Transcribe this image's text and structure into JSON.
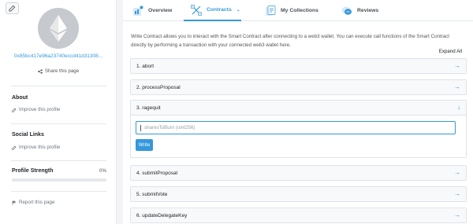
{
  "sidebar": {
    "address": "0x85bc417e96a23740eccd41d31308...",
    "share_label": "Share this page",
    "about": {
      "title": "About",
      "link": "Improve this profile"
    },
    "social": {
      "title": "Social Links",
      "link": "Improve this profile"
    },
    "strength": {
      "label": "Profile Strength",
      "value": "0%",
      "progress": 0
    },
    "report_label": "Report this page"
  },
  "tabs": [
    {
      "label": "Overview",
      "icon": "overview-icon"
    },
    {
      "label": "Contracts",
      "icon": "contracts-icon",
      "active": true
    },
    {
      "label": "My Collections",
      "icon": "collections-icon"
    },
    {
      "label": "Reviews",
      "icon": "reviews-icon"
    }
  ],
  "contracts": {
    "intro": "Write Contract allows you to interact with the Smart Contract after connecting to a web3 wallet. You can execute call functions of the Smart Contract directly by performing a transaction with your connected web3 wallet here.",
    "expand_all": "Expand All",
    "functions": [
      {
        "label": "1. abort"
      },
      {
        "label": "2. processProposal"
      },
      {
        "label": "3. ragequit",
        "open": true
      },
      {
        "label": "4. submitProposal"
      },
      {
        "label": "5. submitVote"
      },
      {
        "label": "6. updateDelegateKey"
      }
    ],
    "ragequit_input_placeholder": "sharesToBurn (uint256)",
    "write_label": "Write"
  },
  "colors": {
    "accent": "#3498db",
    "border": "#dfe3e8"
  }
}
